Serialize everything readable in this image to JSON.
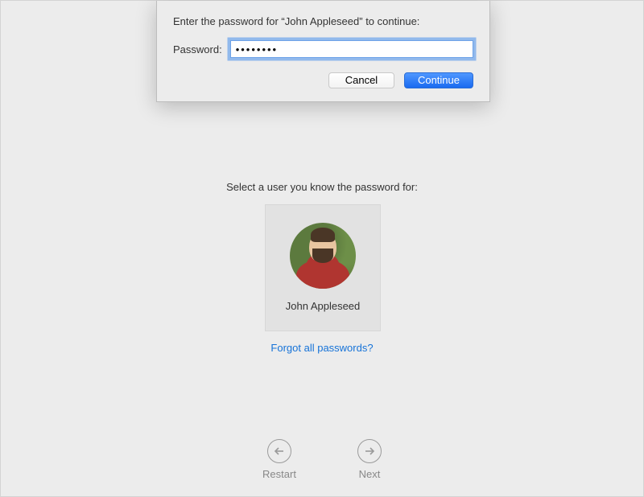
{
  "sheet": {
    "prompt": "Enter the password for “John Appleseed” to continue:",
    "password_label": "Password:",
    "password_value": "••••••••",
    "cancel_label": "Cancel",
    "continue_label": "Continue"
  },
  "main": {
    "select_prompt": "Select a user you know the password for:",
    "user_name": "John Appleseed",
    "forgot_link": "Forgot all passwords?"
  },
  "nav": {
    "restart_label": "Restart",
    "next_label": "Next"
  }
}
